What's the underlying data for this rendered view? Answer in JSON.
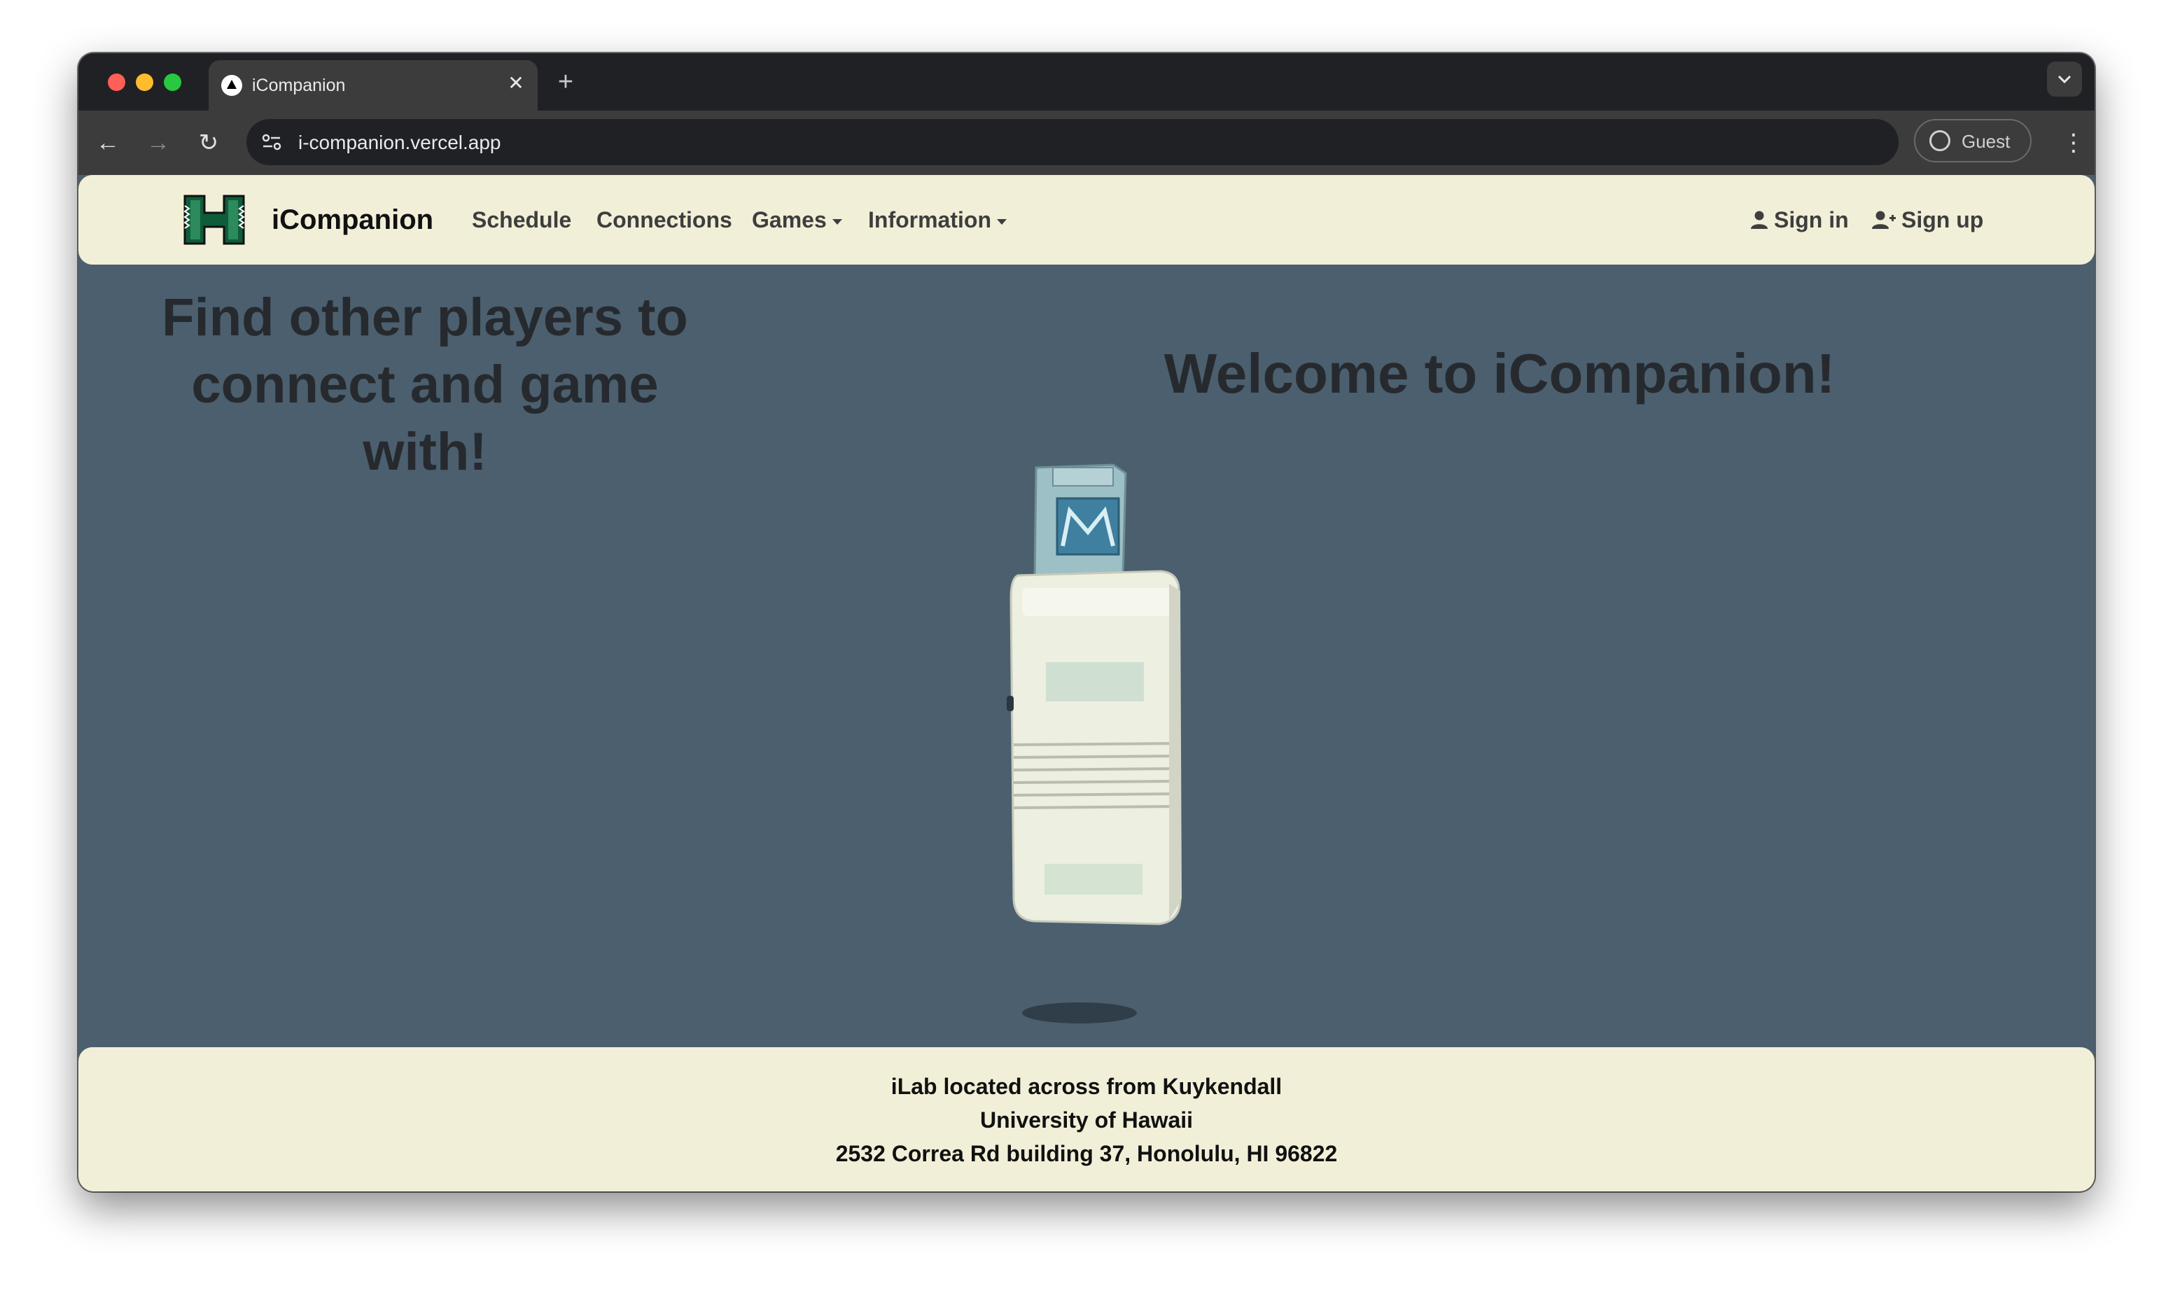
{
  "browser": {
    "tab_title": "iCompanion",
    "tab_close": "✕",
    "new_tab": "+",
    "tab_search": "⌄",
    "url": "i-companion.vercel.app",
    "profile_label": "Guest",
    "back": "←",
    "forward": "→",
    "reload": "↻",
    "menu": "⋮"
  },
  "nav": {
    "brand": "iCompanion",
    "links": [
      "Schedule",
      "Connections",
      "Games",
      "Information"
    ],
    "sign_in": "Sign in",
    "sign_up": "Sign up"
  },
  "hero": {
    "tagline": "Find other players to connect and game with!",
    "title": "Welcome to iCompanion!"
  },
  "footer": {
    "lines": [
      "iLab located across from Kuykendall",
      "University of Hawaii",
      "2532 Correa Rd building 37, Honolulu, HI 96822"
    ]
  },
  "colors": {
    "page_bg": "#4b5f6e",
    "header_bg": "#f2efd8",
    "logo_green": "#0f5c3a"
  },
  "icons": [
    "back-arrow-icon",
    "forward-arrow-icon",
    "reload-icon",
    "site-info-icon",
    "user-icon",
    "user-plus-icon",
    "hawaii-h-logo",
    "kebab-menu-icon"
  ]
}
